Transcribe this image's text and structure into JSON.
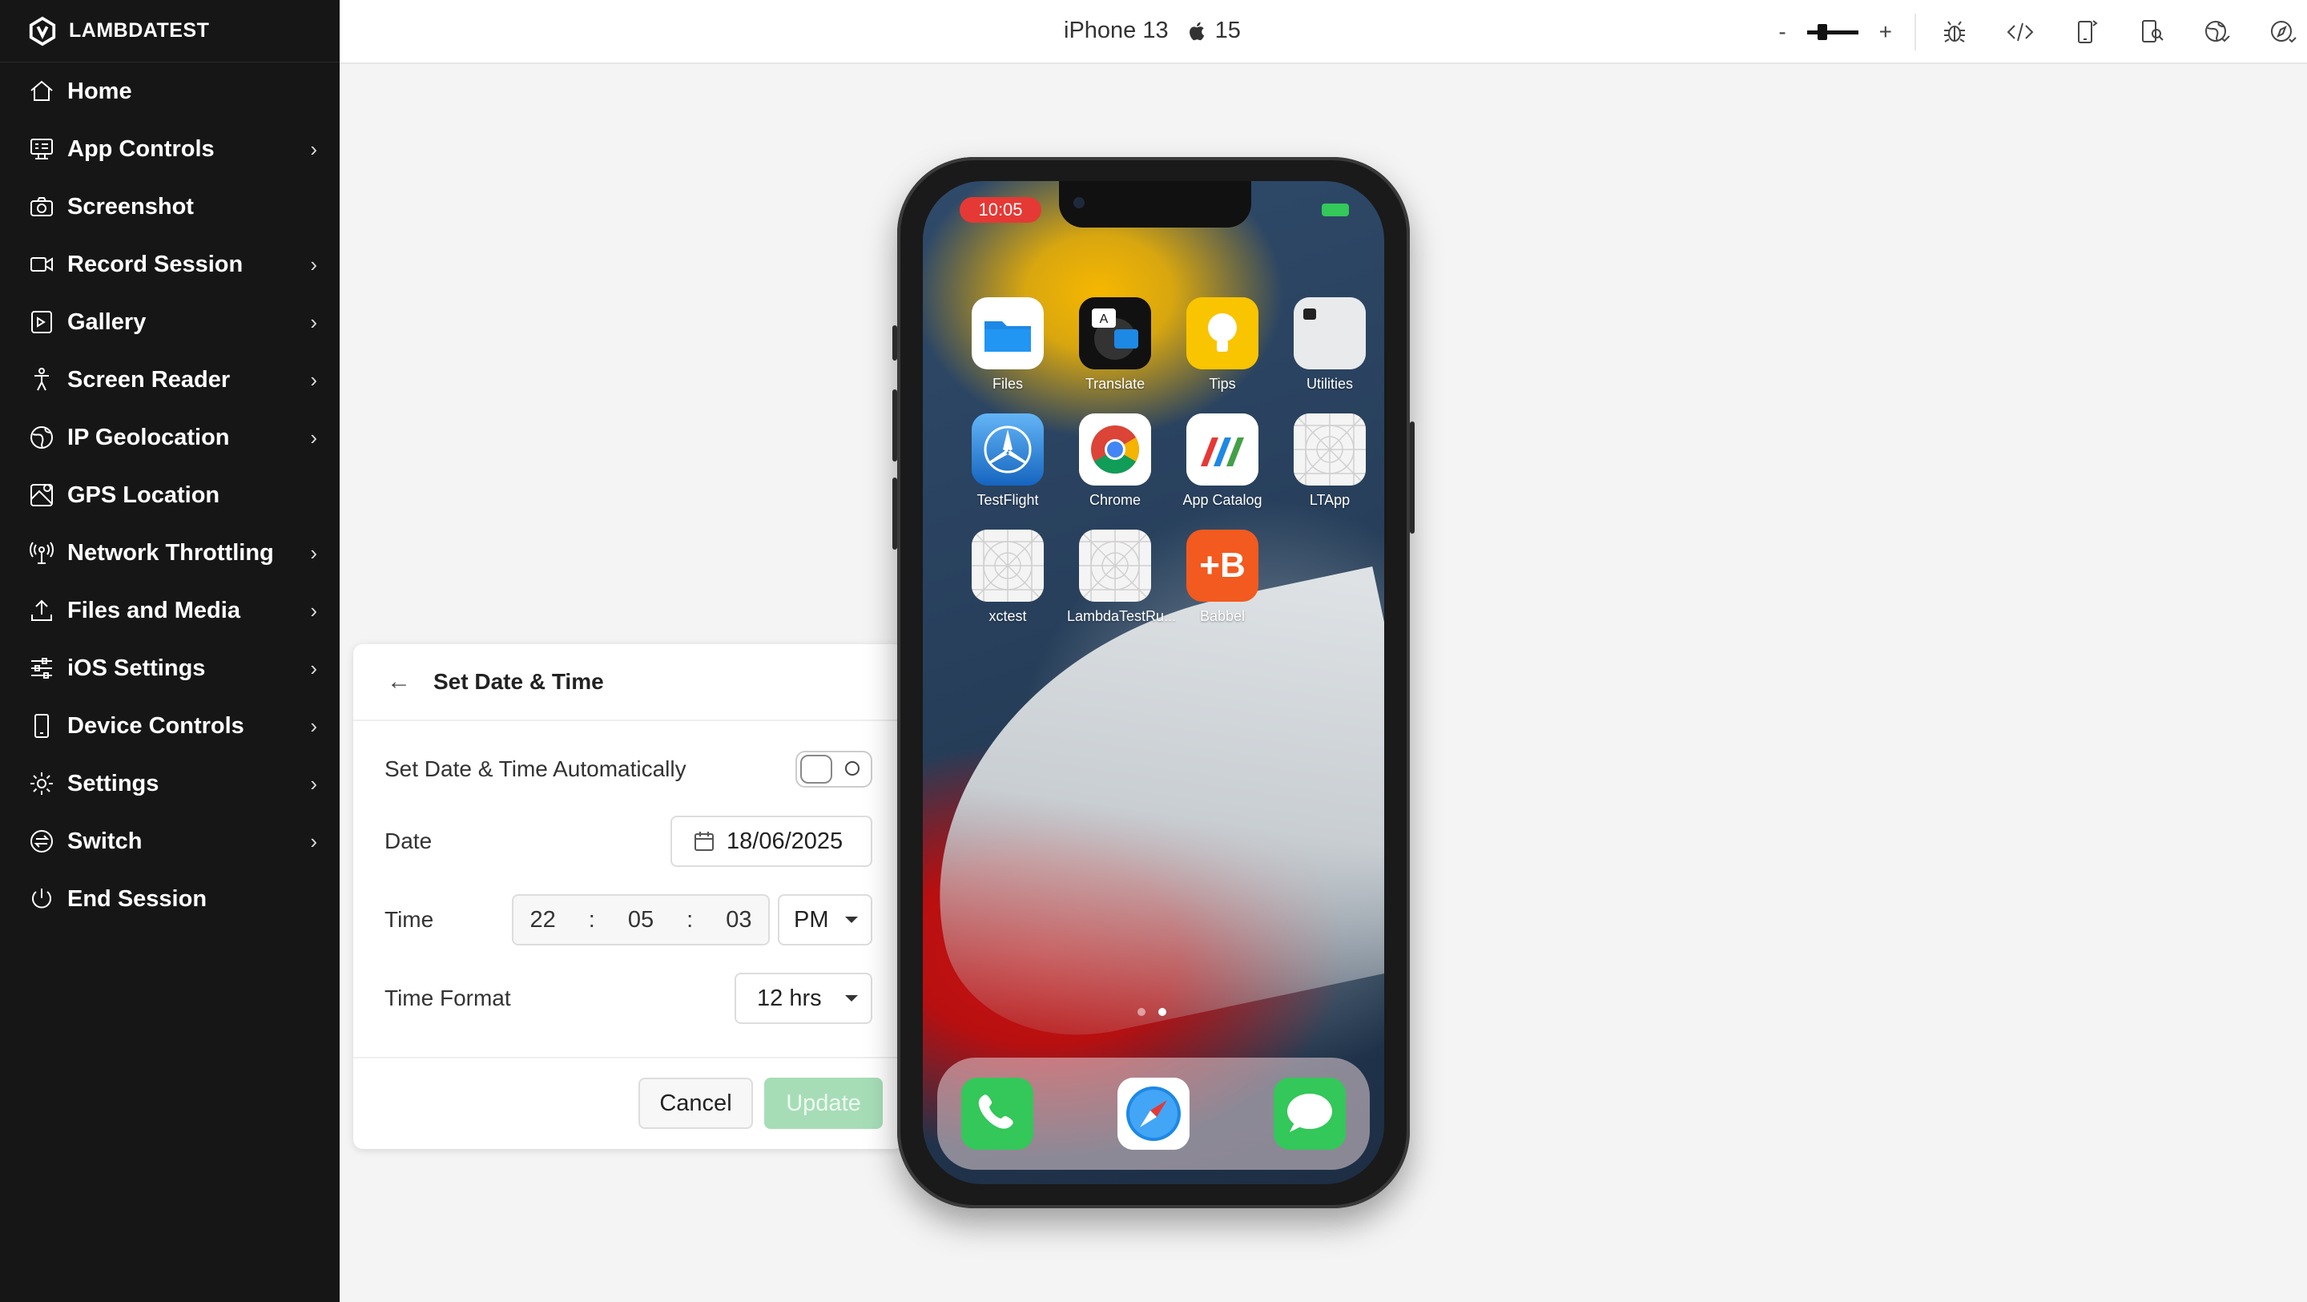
{
  "brand": {
    "name": "LAMBDATEST"
  },
  "sidebar": {
    "items": [
      {
        "label": "Home",
        "icon": "home-icon",
        "has_submenu": false
      },
      {
        "label": "App Controls",
        "icon": "app-controls-icon",
        "has_submenu": true
      },
      {
        "label": "Screenshot",
        "icon": "camera-icon",
        "has_submenu": false
      },
      {
        "label": "Record Session",
        "icon": "video-icon",
        "has_submenu": true
      },
      {
        "label": "Gallery",
        "icon": "gallery-icon",
        "has_submenu": true
      },
      {
        "label": "Screen Reader",
        "icon": "accessibility-icon",
        "has_submenu": true
      },
      {
        "label": "IP Geolocation",
        "icon": "globe-icon",
        "has_submenu": true
      },
      {
        "label": "GPS Location",
        "icon": "map-icon",
        "has_submenu": false
      },
      {
        "label": "Network Throttling",
        "icon": "antenna-icon",
        "has_submenu": true
      },
      {
        "label": "Files and Media",
        "icon": "upload-icon",
        "has_submenu": true
      },
      {
        "label": "iOS Settings",
        "icon": "sliders-icon",
        "has_submenu": true
      },
      {
        "label": "Device Controls",
        "icon": "device-icon",
        "has_submenu": true
      },
      {
        "label": "Settings",
        "icon": "gear-icon",
        "has_submenu": true
      },
      {
        "label": "Switch",
        "icon": "switch-icon",
        "has_submenu": true
      },
      {
        "label": "End Session",
        "icon": "power-icon",
        "has_submenu": false
      }
    ],
    "chevron": "›"
  },
  "topbar": {
    "device_name": "iPhone 13",
    "os_version": "15",
    "zoom_minus": "-",
    "zoom_plus": "+",
    "zoom_level": 0.25,
    "tools": [
      "bug-icon",
      "code-icon",
      "rotate-icon",
      "inspector-icon",
      "globe-check-icon",
      "compass-icon"
    ]
  },
  "panel": {
    "title": "Set Date & Time",
    "back": "←",
    "auto_label": "Set Date & Time Automatically",
    "auto_enabled": false,
    "date_label": "Date",
    "date_value": "18/06/2025",
    "time_label": "Time",
    "hour": "22",
    "minute": "05",
    "second": "03",
    "separator": ":",
    "ampm": "PM",
    "format_label": "Time Format",
    "format_value": "12 hrs",
    "cancel": "Cancel",
    "update": "Update"
  },
  "phone": {
    "status_time": "10:05",
    "apps": [
      {
        "name": "Files",
        "icon": "files-icon",
        "color": "#1e88e5"
      },
      {
        "name": "Translate",
        "icon": "translate-icon",
        "color": "#111111"
      },
      {
        "name": "Tips",
        "icon": "lightbulb-icon",
        "color": "#f9c400"
      },
      {
        "name": "Utilities",
        "icon": "folder-icon",
        "color": "#e9eaec"
      },
      {
        "name": "TestFlight",
        "icon": "testflight-icon",
        "color": "#1976d2"
      },
      {
        "name": "Chrome",
        "icon": "chrome-icon",
        "color": "#ffffff"
      },
      {
        "name": "App Catalog",
        "icon": "app-catalog-icon",
        "color": "#ffffff"
      },
      {
        "name": "LTApp",
        "icon": "placeholder-icon",
        "color": "#f4f4f4"
      },
      {
        "name": "xctest",
        "icon": "placeholder-icon",
        "color": "#f4f4f4"
      },
      {
        "name": "LambdaTestRu...",
        "icon": "placeholder-icon",
        "color": "#f4f4f4"
      },
      {
        "name": "Babbel",
        "icon": "babbel-icon",
        "color": "#f25a1f"
      }
    ],
    "babbel_text": "+B",
    "dock": [
      {
        "name": "Phone",
        "icon": "phone-icon",
        "color": "#34c759"
      },
      {
        "name": "Safari",
        "icon": "safari-icon",
        "color": "#ffffff"
      },
      {
        "name": "Messages",
        "icon": "messages-icon",
        "color": "#34c759"
      }
    ]
  }
}
